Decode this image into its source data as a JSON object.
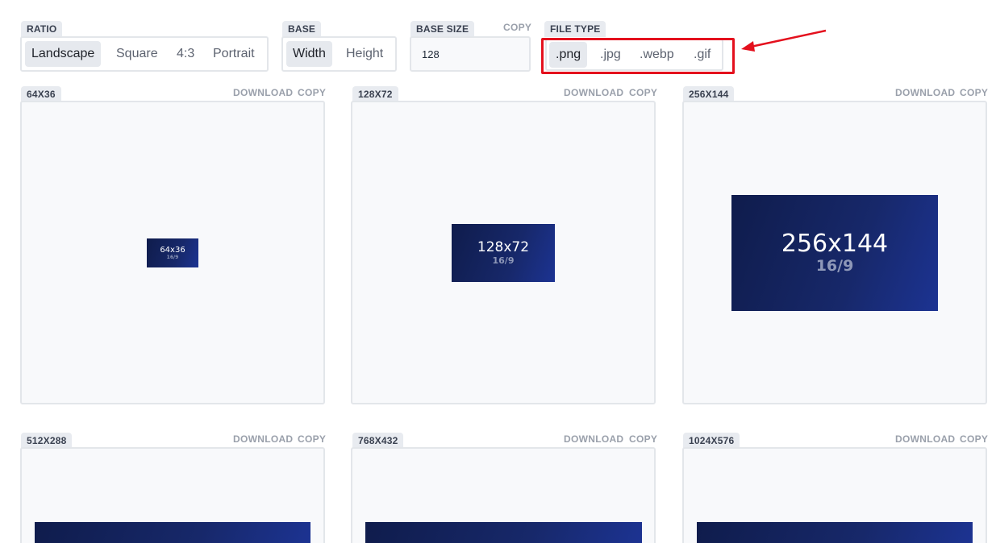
{
  "controls": {
    "ratio": {
      "label": "RATIO",
      "options": [
        "Landscape",
        "Square",
        "4:3",
        "Portrait"
      ],
      "selected": "Landscape"
    },
    "base": {
      "label": "BASE",
      "options": [
        "Width",
        "Height"
      ],
      "selected": "Width"
    },
    "base_size": {
      "label": "BASE SIZE",
      "copy": "COPY",
      "value": "128"
    },
    "file_type": {
      "label": "FILE TYPE",
      "options": [
        ".png",
        ".jpg",
        ".webp",
        ".gif"
      ],
      "selected": ".png"
    }
  },
  "card_actions": {
    "download": "DOWNLOAD",
    "copy": "COPY"
  },
  "cards": [
    {
      "label": "64X36",
      "dim": "64x36",
      "ratio": "16/9"
    },
    {
      "label": "128X72",
      "dim": "128x72",
      "ratio": "16/9"
    },
    {
      "label": "256X144",
      "dim": "256x144",
      "ratio": "16/9"
    },
    {
      "label": "512X288"
    },
    {
      "label": "768X432"
    },
    {
      "label": "1024X576"
    }
  ],
  "colors": {
    "highlight": "#e4101d",
    "preview_dark": "#0f1c4c",
    "preview_light": "#1c3392"
  }
}
